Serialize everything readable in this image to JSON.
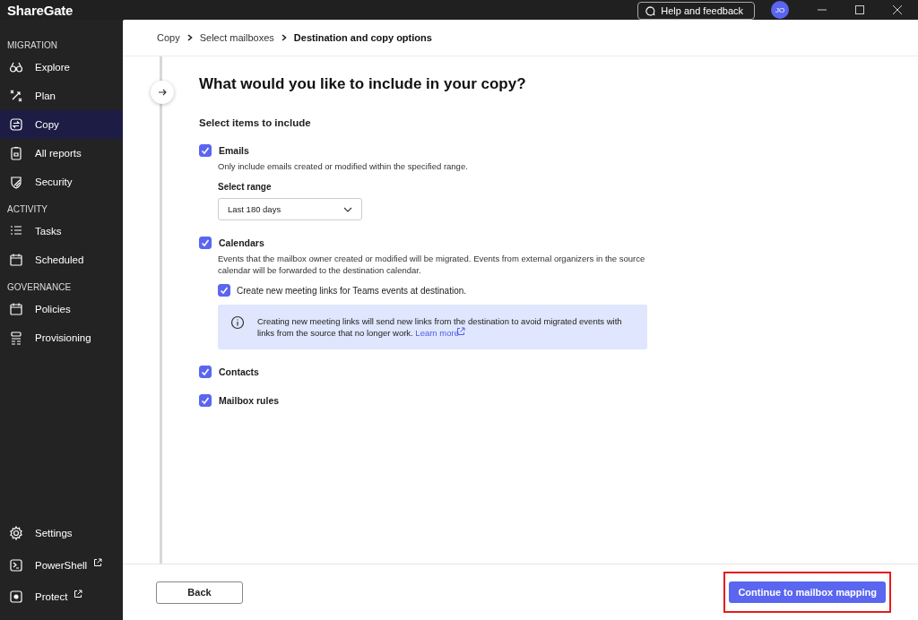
{
  "app": {
    "logo": "ShareGate",
    "help": "Help and feedback",
    "avatar": "JO"
  },
  "sidebar": {
    "sections": [
      {
        "heading": "MIGRATION",
        "items": [
          {
            "label": "Explore",
            "selected": false
          },
          {
            "label": "Plan",
            "selected": false
          },
          {
            "label": "Copy",
            "selected": true
          },
          {
            "label": "All reports",
            "selected": false
          },
          {
            "label": "Security",
            "selected": false
          }
        ]
      },
      {
        "heading": "ACTIVITY",
        "items": [
          {
            "label": "Tasks",
            "selected": false
          },
          {
            "label": "Scheduled",
            "selected": false
          }
        ]
      },
      {
        "heading": "GOVERNANCE",
        "items": [
          {
            "label": "Policies",
            "selected": false
          },
          {
            "label": "Provisioning",
            "selected": false
          }
        ]
      }
    ],
    "bottom_items": [
      {
        "label": "Settings",
        "external": false
      },
      {
        "label": "PowerShell",
        "external": true
      },
      {
        "label": "Protect",
        "external": true
      }
    ]
  },
  "breadcrumb": [
    "Copy",
    "Select mailboxes",
    "Destination and copy options"
  ],
  "title": "What would you like to include in your copy?",
  "subtitle": "Select items to include",
  "options": [
    {
      "label": "Emails",
      "checked": true,
      "description": "Only include emails created or modified within the specified range.",
      "field": {
        "label": "Select range",
        "value": "Last 180 days"
      }
    },
    {
      "label": "Calendars",
      "checked": true,
      "description": "Events that the mailbox owner created or modified will be migrated. Events from external organizers in the source calendar will be forwarded to the destination calendar.",
      "suboptions": [
        {
          "label": "Create new meeting links for Teams events at destination.",
          "checked": true
        }
      ],
      "note": {
        "text": "Creating new meeting links will send new links from the destination to avoid migrated events with links from the source that no longer work.",
        "link": "Learn more"
      }
    },
    {
      "label": "Contacts",
      "checked": true
    },
    {
      "label": "Mailbox rules",
      "checked": true
    }
  ],
  "footer": {
    "back": "Back",
    "continue": {
      "label": "Continue to mailbox mapping",
      "highlighted": true
    }
  }
}
